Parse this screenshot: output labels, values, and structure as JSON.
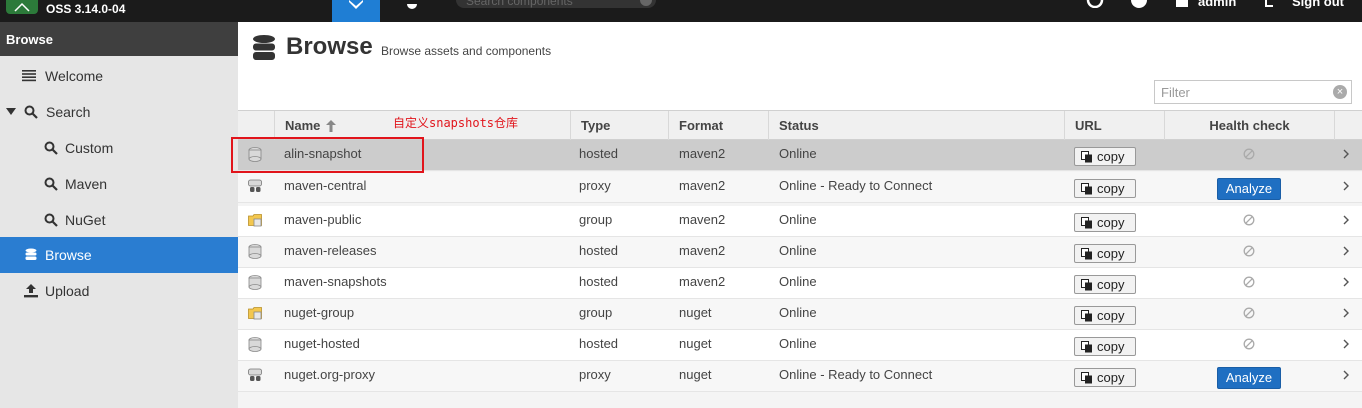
{
  "topbar": {
    "product": "OSS 3.14.0-04",
    "search_placeholder": "Search components",
    "user": "admin",
    "signout": "Sign out"
  },
  "sidebar": {
    "header": "Browse",
    "items": [
      {
        "label": "Welcome",
        "icon": "welcome-icon"
      },
      {
        "label": "Search",
        "icon": "search-icon"
      },
      {
        "label": "Custom",
        "icon": "search-icon"
      },
      {
        "label": "Maven",
        "icon": "search-icon"
      },
      {
        "label": "NuGet",
        "icon": "search-icon"
      },
      {
        "label": "Browse",
        "icon": "database-icon"
      },
      {
        "label": "Upload",
        "icon": "upload-icon"
      }
    ]
  },
  "page": {
    "title": "Browse",
    "subtitle": "Browse assets and components",
    "filter_placeholder": "Filter"
  },
  "grid": {
    "columns": [
      "Name",
      "Type",
      "Format",
      "Status",
      "URL",
      "Health check"
    ],
    "copy_label": "copy",
    "analyze_label": "Analyze",
    "rows": [
      {
        "name": "alin-snapshot",
        "type": "hosted",
        "format": "maven2",
        "status": "Online",
        "health": "none"
      },
      {
        "name": "maven-central",
        "type": "proxy",
        "format": "maven2",
        "status": "Online - Ready to Connect",
        "health": "analyze"
      },
      {
        "name": "maven-public",
        "type": "group",
        "format": "maven2",
        "status": "Online",
        "health": "none"
      },
      {
        "name": "maven-releases",
        "type": "hosted",
        "format": "maven2",
        "status": "Online",
        "health": "none"
      },
      {
        "name": "maven-snapshots",
        "type": "hosted",
        "format": "maven2",
        "status": "Online",
        "health": "none"
      },
      {
        "name": "nuget-group",
        "type": "group",
        "format": "nuget",
        "status": "Online",
        "health": "none"
      },
      {
        "name": "nuget-hosted",
        "type": "hosted",
        "format": "nuget",
        "status": "Online",
        "health": "none"
      },
      {
        "name": "nuget.org-proxy",
        "type": "proxy",
        "format": "nuget",
        "status": "Online - Ready to Connect",
        "health": "analyze"
      }
    ]
  },
  "annotation": {
    "text": "自定义snapshots仓库",
    "color": "#e1141b"
  },
  "colors": {
    "accent": "#2a7dd1",
    "topbar": "#1b1b1b",
    "selected_row": "#cccccc"
  }
}
